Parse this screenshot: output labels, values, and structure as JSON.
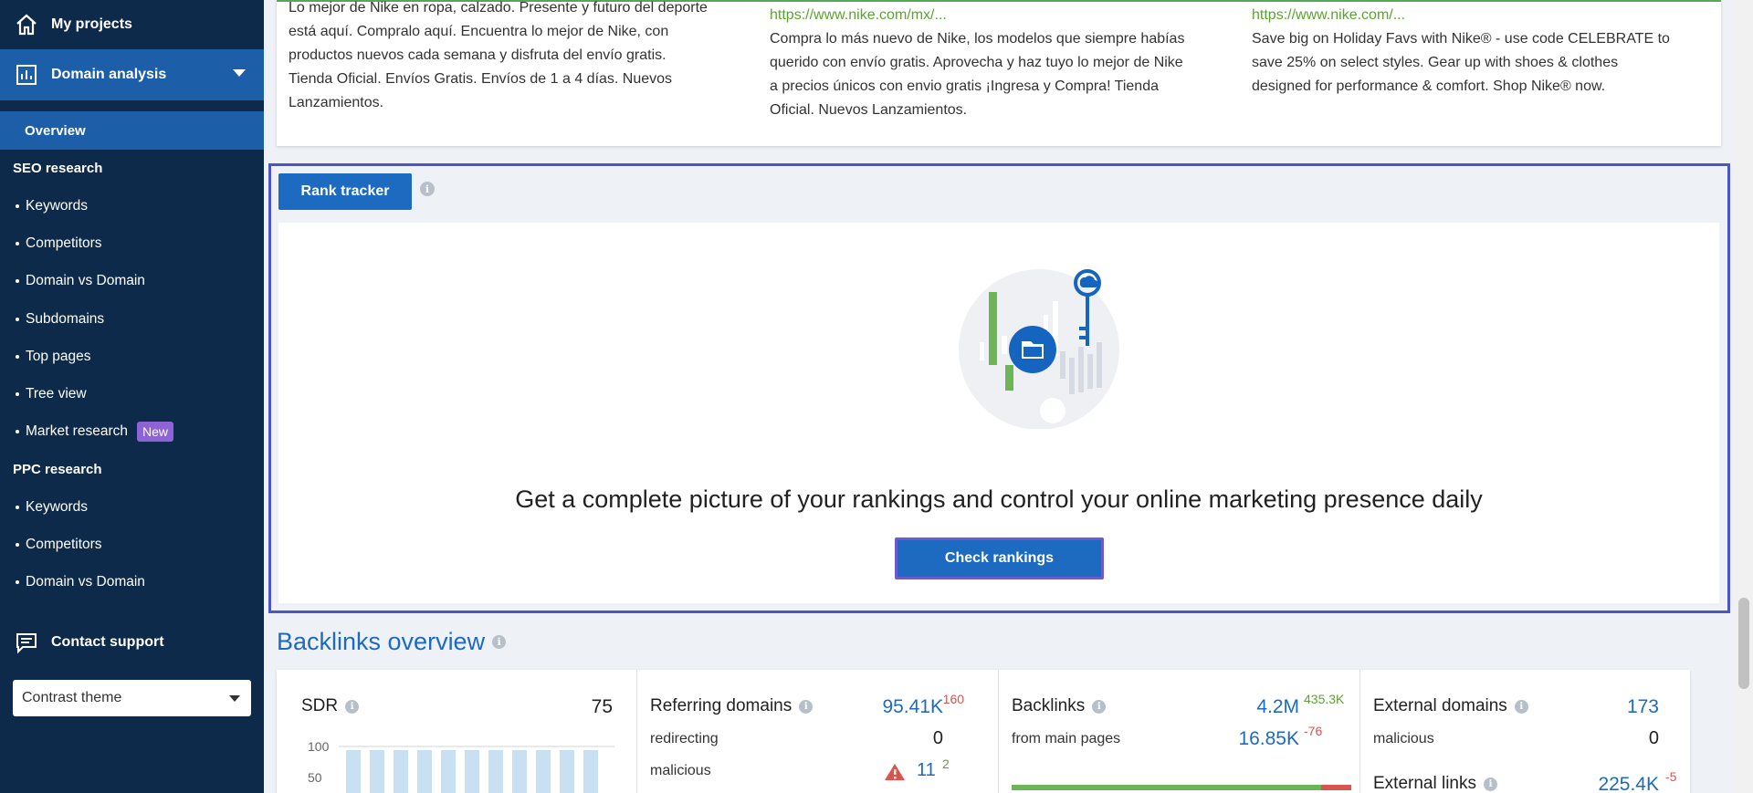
{
  "sidebar": {
    "my_projects": "My projects",
    "domain_analysis": "Domain analysis",
    "overview": "Overview",
    "seo_research": {
      "title": "SEO research",
      "items": [
        "Keywords",
        "Competitors",
        "Domain vs Domain",
        "Subdomains",
        "Top pages",
        "Tree view",
        "Market research"
      ]
    },
    "market_badge": "New",
    "ppc_research": {
      "title": "PPC research",
      "items": [
        "Keywords",
        "Competitors",
        "Domain vs Domain"
      ]
    },
    "contact_support": "Contact support",
    "theme_select": "Contrast theme"
  },
  "ads": [
    {
      "lines": [
        "Lo mejor de Nike en ropa, calzado. Presente y futuro del deporte",
        "está aquí. Compralo aquí. Encuentra lo mejor de Nike, con",
        "productos nuevos cada semana y disfruta del envío gratis.",
        "Tienda Oficial. Envíos Gratis. Envíos de 1 a 4 días. Nuevos",
        "Lanzamientos."
      ]
    },
    {
      "url": "https://www.nike.com/mx/...",
      "lines": [
        "Compra lo más nuevo de Nike, los modelos que siempre habías",
        "querido con envío gratis. Aprovecha y haz tuyo lo mejor de Nike",
        "a precios únicos con envio gratis ¡Ingresa y Compra! Tienda",
        "Oficial. Nuevos Lanzamientos."
      ]
    },
    {
      "url": "https://www.nike.com/...",
      "lines": [
        "Save big on Holiday Favs with Nike® - use code CELEBRATE to",
        "save 25% on select styles. Gear up with shoes & clothes",
        "designed for performance & comfort. Shop Nike® now."
      ]
    }
  ],
  "rank_tracker": {
    "tab": "Rank tracker",
    "headline": "Get a complete picture of your rankings and control your online marketing presence daily",
    "cta": "Check rankings"
  },
  "backlinks": {
    "title": "Backlinks overview",
    "sdr": {
      "label": "SDR",
      "value": "75",
      "ticks": [
        "100",
        "50"
      ]
    },
    "referring": {
      "label": "Referring domains",
      "value": "95.41K",
      "delta": "-160",
      "redirecting_label": "redirecting",
      "redirecting_value": "0",
      "malicious_label": "malicious",
      "malicious_value": "11",
      "malicious_delta": "2"
    },
    "backlinks": {
      "label": "Backlinks",
      "value": "4.2M",
      "delta": "435.3K",
      "main_label": "from main pages",
      "main_value": "16.85K",
      "main_delta": "-76",
      "bar_fraction": 0.91
    },
    "external": {
      "label": "External domains",
      "value": "173",
      "malicious_label": "malicious",
      "malicious_value": "0",
      "links_label": "External links",
      "links_value": "225.4K",
      "links_delta": "-5"
    }
  },
  "colors": {
    "accent": "#1c6bc0",
    "sidebar": "#0d2a4a",
    "highlight": "#4d55c2",
    "green": "#5aa52f",
    "red": "#d9534f"
  }
}
